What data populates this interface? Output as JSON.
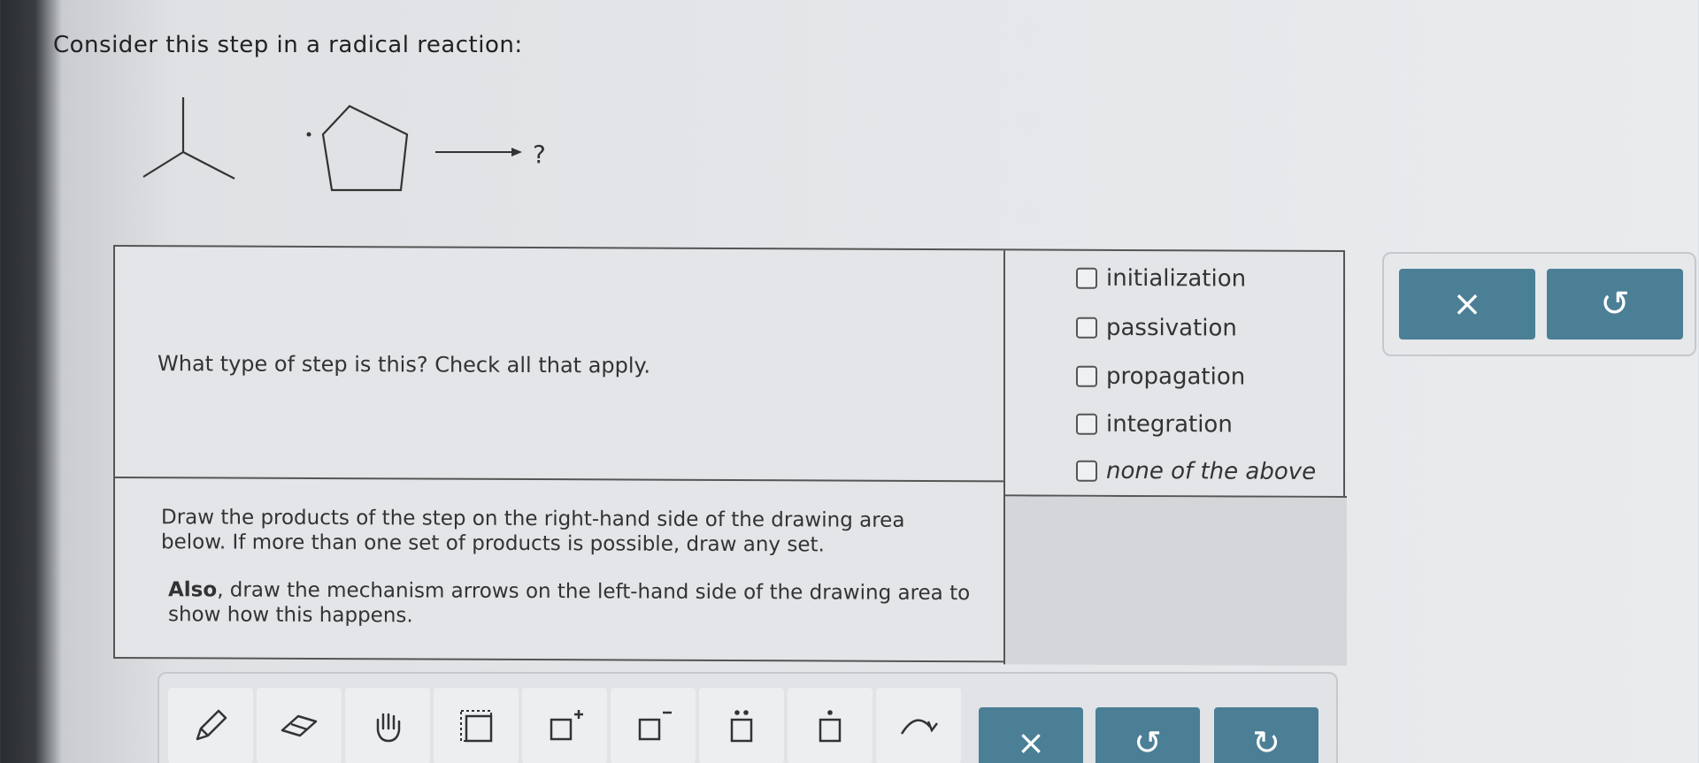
{
  "prompt": "Consider this step in a radical reaction:",
  "reaction": {
    "product_placeholder": "?"
  },
  "question": {
    "text": "What type of step is this? Check all that apply.",
    "options": [
      {
        "label": "initialization",
        "checked": false
      },
      {
        "label": "passivation",
        "checked": false
      },
      {
        "label": "propagation",
        "checked": false
      },
      {
        "label": "integration",
        "checked": false
      },
      {
        "label": "none of the above",
        "checked": false
      }
    ]
  },
  "draw_instructions": {
    "p1": "Draw the products of the step on the right-hand side of the drawing area below. If more than one set of products is possible, draw any set.",
    "p2_bold": "Also",
    "p2_rest": ", draw the mechanism arrows on the left-hand side of the drawing area to show how this happens."
  },
  "side_actions": {
    "clear_icon": "×",
    "undo_icon": "↺"
  },
  "toolbar": {
    "tools": [
      "pencil-icon",
      "eraser-icon",
      "hand-icon",
      "select-box-icon",
      "add-charge-plus-icon",
      "add-charge-minus-icon",
      "lone-pair-icon",
      "radical-dot-icon",
      "curved-arrow-icon"
    ],
    "clear_icon": "×",
    "undo_icon": "↺",
    "redo_icon": "↻",
    "accent_color": "#4b7f96"
  }
}
